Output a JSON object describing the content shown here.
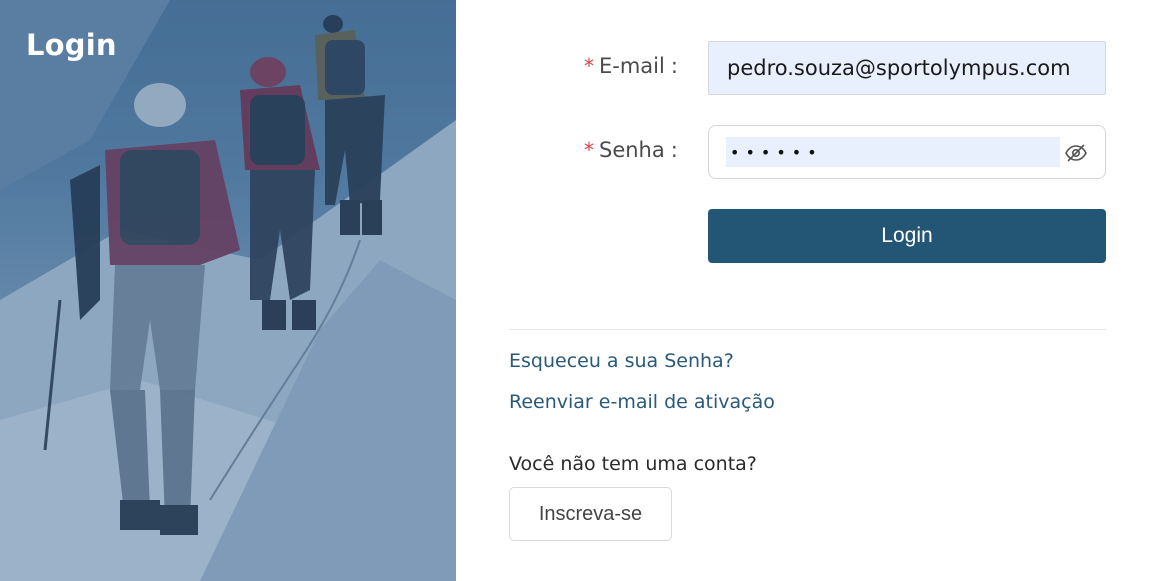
{
  "hero": {
    "title": "Login"
  },
  "form": {
    "email": {
      "label": "E-mail",
      "required_mark": "*",
      "value": "pedro.souza@sportolympus.com"
    },
    "password": {
      "label": "Senha",
      "required_mark": "*",
      "value": "••••••",
      "toggle_icon": "eye-slash-icon"
    },
    "login_label": "Login"
  },
  "links": {
    "forgot": "Esqueceu a sua Senha?",
    "resend": "Reenviar e-mail de ativação"
  },
  "signup": {
    "question": "Você não tem uma conta?",
    "button_label": "Inscreva-se"
  },
  "colors": {
    "primary": "#235574",
    "link": "#2a5a7a",
    "required": "#d9434e",
    "autofill": "#e8f0fd"
  }
}
